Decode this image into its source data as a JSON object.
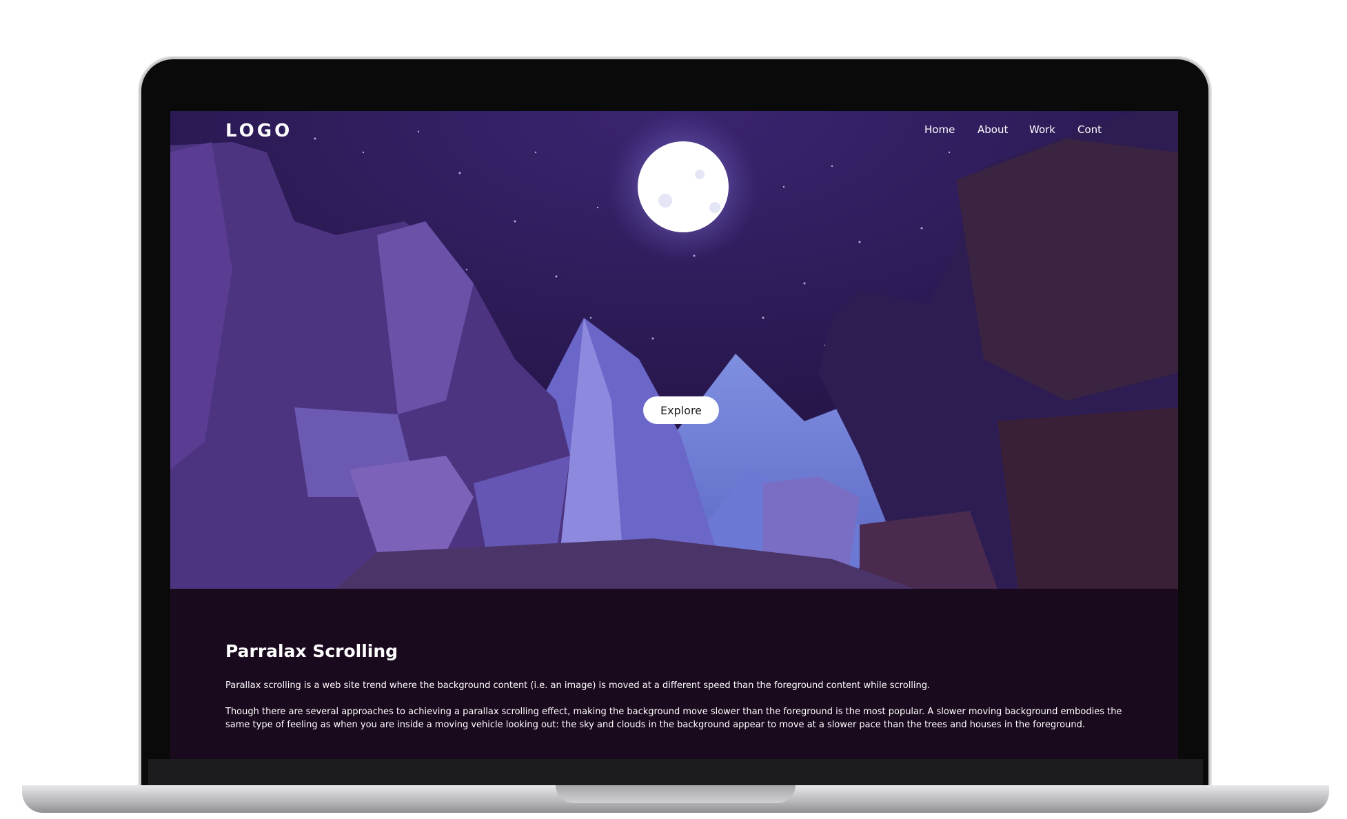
{
  "header": {
    "logo": "LOGO",
    "nav": [
      "Home",
      "About",
      "Work",
      "Contact"
    ]
  },
  "hero": {
    "cta_label": "Explore"
  },
  "article": {
    "title": "Parralax Scrolling",
    "paragraph1": "Parallax scrolling is a web site trend where the background content (i.e. an image) is moved at a different speed than the foreground content while scrolling.",
    "paragraph2": "Though there are several approaches to achieving a parallax scrolling effect, making the background move slower than the foreground is the most popular. A slower moving background embodies the same type of feeling as when you are inside a moving vehicle looking out: the sky and clouds in the background appear to move at a slower pace than the trees and houses in the foreground."
  },
  "colors": {
    "sky": "#2a1850",
    "moon": "#ffffff",
    "content_bg": "#1a0a1e"
  }
}
